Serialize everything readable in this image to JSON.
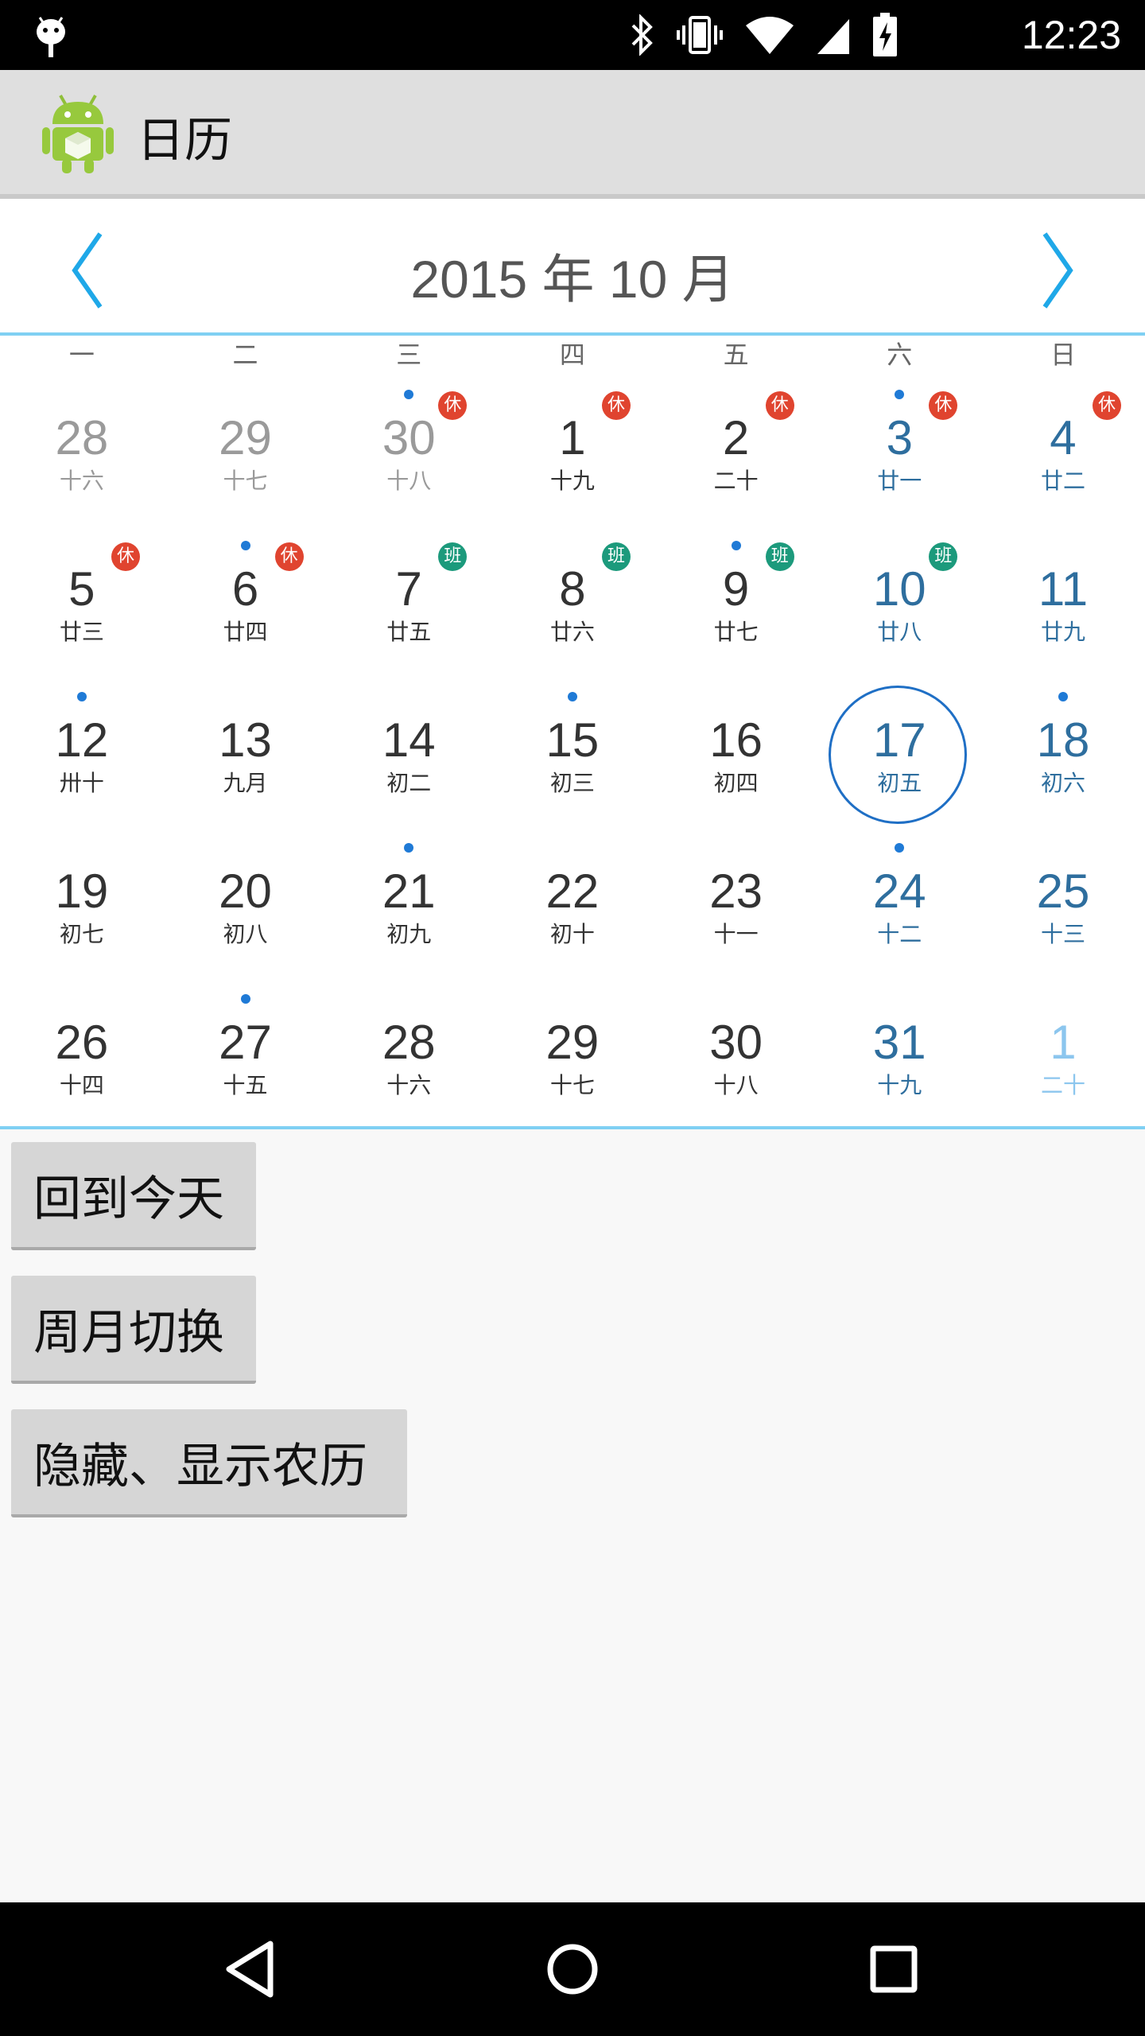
{
  "status_bar": {
    "time": "12:23",
    "icons": [
      "android-notification-icon",
      "bluetooth-icon",
      "vibrate-icon",
      "wifi-icon",
      "signal-icon",
      "battery-charging-icon"
    ]
  },
  "app_bar": {
    "title": "日历",
    "icon": "android-app-icon"
  },
  "calendar": {
    "month_title": "2015 年 10 月",
    "weekdays": [
      "一",
      "二",
      "三",
      "四",
      "五",
      "六",
      "日"
    ],
    "colors": {
      "accent": "#1fa8e8",
      "weekend": "#2e6e9e",
      "rest_badge": "#e0442f",
      "work_badge": "#1c9a7c",
      "dot": "#1f7ad6"
    },
    "weeks": [
      [
        {
          "day": "28",
          "lunar": "十六",
          "type": "other",
          "dot": false,
          "badge": ""
        },
        {
          "day": "29",
          "lunar": "十七",
          "type": "other",
          "dot": false,
          "badge": ""
        },
        {
          "day": "30",
          "lunar": "十八",
          "type": "other",
          "dot": true,
          "badge": "休"
        },
        {
          "day": "1",
          "lunar": "十九",
          "type": "normal",
          "dot": false,
          "badge": "休"
        },
        {
          "day": "2",
          "lunar": "二十",
          "type": "normal",
          "dot": false,
          "badge": "休"
        },
        {
          "day": "3",
          "lunar": "廿一",
          "type": "weekend",
          "dot": true,
          "badge": "休"
        },
        {
          "day": "4",
          "lunar": "廿二",
          "type": "weekend",
          "dot": false,
          "badge": "休"
        }
      ],
      [
        {
          "day": "5",
          "lunar": "廿三",
          "type": "normal",
          "dot": false,
          "badge": "休"
        },
        {
          "day": "6",
          "lunar": "廿四",
          "type": "normal",
          "dot": true,
          "badge": "休"
        },
        {
          "day": "7",
          "lunar": "廿五",
          "type": "normal",
          "dot": false,
          "badge": "班"
        },
        {
          "day": "8",
          "lunar": "廿六",
          "type": "normal",
          "dot": false,
          "badge": "班"
        },
        {
          "day": "9",
          "lunar": "廿七",
          "type": "normal",
          "dot": true,
          "badge": "班"
        },
        {
          "day": "10",
          "lunar": "廿八",
          "type": "weekend",
          "dot": false,
          "badge": "班"
        },
        {
          "day": "11",
          "lunar": "廿九",
          "type": "weekend",
          "dot": false,
          "badge": ""
        }
      ],
      [
        {
          "day": "12",
          "lunar": "卅十",
          "type": "normal",
          "dot": true,
          "badge": ""
        },
        {
          "day": "13",
          "lunar": "九月",
          "type": "normal",
          "dot": false,
          "badge": ""
        },
        {
          "day": "14",
          "lunar": "初二",
          "type": "normal",
          "dot": false,
          "badge": ""
        },
        {
          "day": "15",
          "lunar": "初三",
          "type": "normal",
          "dot": true,
          "badge": ""
        },
        {
          "day": "16",
          "lunar": "初四",
          "type": "normal",
          "dot": false,
          "badge": ""
        },
        {
          "day": "17",
          "lunar": "初五",
          "type": "weekend",
          "dot": false,
          "badge": "",
          "selected": true
        },
        {
          "day": "18",
          "lunar": "初六",
          "type": "weekend",
          "dot": true,
          "badge": ""
        }
      ],
      [
        {
          "day": "19",
          "lunar": "初七",
          "type": "normal",
          "dot": false,
          "badge": ""
        },
        {
          "day": "20",
          "lunar": "初八",
          "type": "normal",
          "dot": false,
          "badge": ""
        },
        {
          "day": "21",
          "lunar": "初九",
          "type": "normal",
          "dot": true,
          "badge": ""
        },
        {
          "day": "22",
          "lunar": "初十",
          "type": "normal",
          "dot": false,
          "badge": ""
        },
        {
          "day": "23",
          "lunar": "十一",
          "type": "normal",
          "dot": false,
          "badge": ""
        },
        {
          "day": "24",
          "lunar": "十二",
          "type": "weekend",
          "dot": true,
          "badge": ""
        },
        {
          "day": "25",
          "lunar": "十三",
          "type": "weekend",
          "dot": false,
          "badge": ""
        }
      ],
      [
        {
          "day": "26",
          "lunar": "十四",
          "type": "normal",
          "dot": false,
          "badge": ""
        },
        {
          "day": "27",
          "lunar": "十五",
          "type": "normal",
          "dot": true,
          "badge": ""
        },
        {
          "day": "28",
          "lunar": "十六",
          "type": "normal",
          "dot": false,
          "badge": ""
        },
        {
          "day": "29",
          "lunar": "十七",
          "type": "normal",
          "dot": false,
          "badge": ""
        },
        {
          "day": "30",
          "lunar": "十八",
          "type": "normal",
          "dot": false,
          "badge": ""
        },
        {
          "day": "31",
          "lunar": "十九",
          "type": "weekend",
          "dot": false,
          "badge": ""
        },
        {
          "day": "1",
          "lunar": "二十",
          "type": "next",
          "dot": false,
          "badge": ""
        }
      ]
    ]
  },
  "buttons": {
    "today": "回到今天",
    "toggle_week_month": "周月切换",
    "toggle_lunar": "隐藏、显示农历"
  },
  "nav_bar": {
    "icons": [
      "back-icon",
      "home-icon",
      "recents-icon"
    ]
  }
}
